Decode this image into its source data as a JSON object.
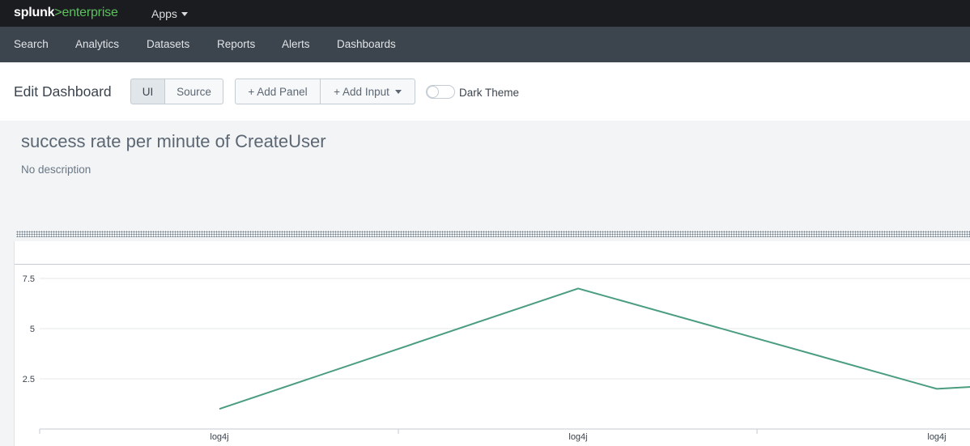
{
  "topbar": {
    "logo_word": "splunk",
    "logo_suffix": ">enterprise",
    "apps_label": "Apps"
  },
  "appbar": {
    "items": [
      "Search",
      "Analytics",
      "Datasets",
      "Reports",
      "Alerts",
      "Dashboards"
    ]
  },
  "editbar": {
    "title": "Edit Dashboard",
    "ui_label": "UI",
    "source_label": "Source",
    "add_panel_label": "+ Add Panel",
    "add_input_label": "+ Add Input",
    "dark_theme_label": "Dark Theme",
    "dark_theme_on": false
  },
  "dashboard": {
    "title": "success rate per minute of CreateUser",
    "description": "No description"
  },
  "colors": {
    "series": "#4a9d7f",
    "gridline": "#e6e8ea",
    "topbar": "#1a1c20",
    "appbar": "#3c444d"
  },
  "chart_data": {
    "type": "line",
    "categories": [
      "log4j",
      "log4j",
      "log4j"
    ],
    "y_ticks": [
      "2.5",
      "5",
      "7.5"
    ],
    "ylim": [
      0,
      7.5
    ],
    "grid": true,
    "series": [
      {
        "x": [
          0,
          1,
          2,
          2.1
        ],
        "values": [
          1,
          7,
          2,
          2.1
        ]
      }
    ]
  }
}
